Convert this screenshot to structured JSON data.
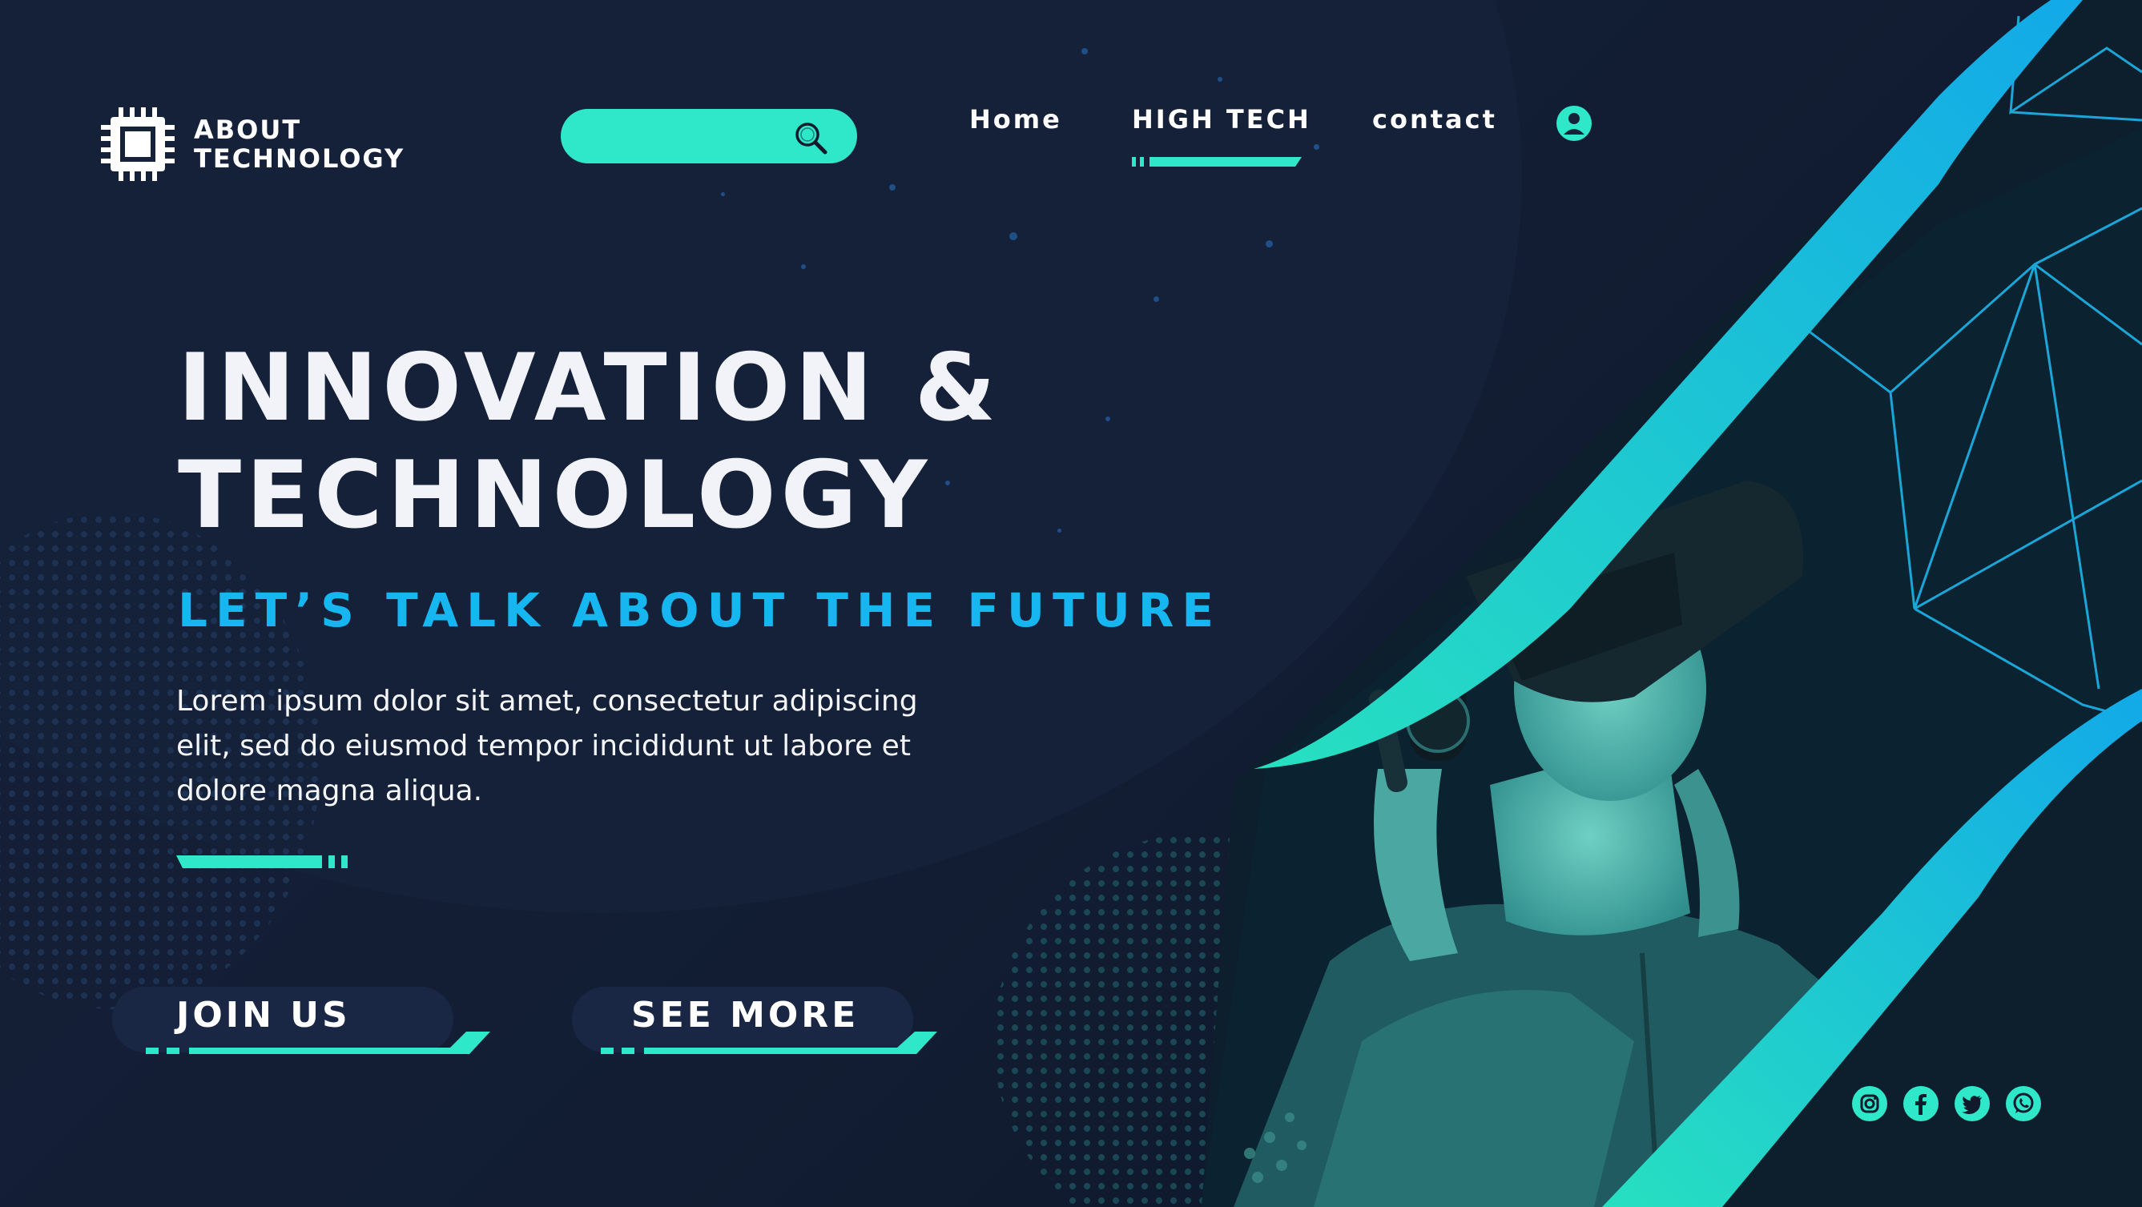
{
  "brand": {
    "line1": "ABOUT",
    "line2": "TECHNOLOGY",
    "icon": "chip-icon"
  },
  "search": {
    "placeholder": "",
    "icon": "search-icon"
  },
  "nav": {
    "items": [
      {
        "label": "Home"
      },
      {
        "label": "HIGH TECH",
        "active": true
      },
      {
        "label": "contact"
      }
    ],
    "user_icon": "user-icon"
  },
  "hero": {
    "title": "INNOVATION &\nTECHNOLOGY",
    "subtitle": "LET’S TALK ABOUT THE FUTURE",
    "body": "Lorem ipsum dolor sit amet, consectetur adipiscing elit, sed do eiusmod tempor incididunt ut labore et dolore magna aliqua."
  },
  "buttons": {
    "join": "JOIN US",
    "see_more": "SEE MORE"
  },
  "social": [
    "instagram-icon",
    "facebook-icon",
    "twitter-icon",
    "whatsapp-icon"
  ],
  "colors": {
    "background": "#121d33",
    "accent_teal": "#2ee8c9",
    "accent_blue": "#16b6f0",
    "text": "#f1f3f8"
  }
}
